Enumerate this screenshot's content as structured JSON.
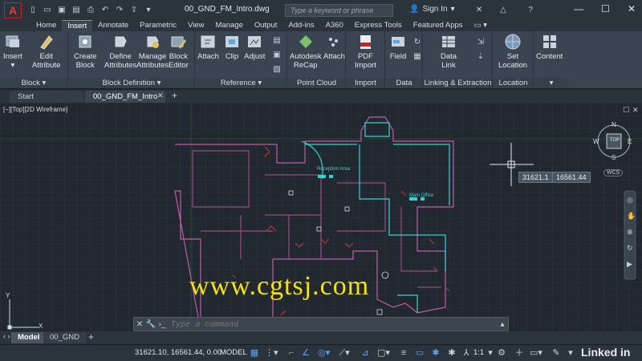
{
  "window": {
    "doc_title": "00_GND_FM_Intro.dwg",
    "search_placeholder": "Type a keyword or phrase",
    "sign_in": "Sign In",
    "minimize": "—",
    "maximize": "☐",
    "close": "✕"
  },
  "ribbon_tabs": [
    "Home",
    "Insert",
    "Annotate",
    "Parametric",
    "View",
    "Manage",
    "Output",
    "Add-ins",
    "A360",
    "Express Tools",
    "Featured Apps"
  ],
  "ribbon": {
    "insert": "Insert",
    "edit_attribute": [
      "Edit",
      "Attribute"
    ],
    "create_block": [
      "Create",
      "Block"
    ],
    "define_attributes": [
      "Define",
      "Attributes"
    ],
    "manage_attributes": [
      "Manage",
      "Attributes"
    ],
    "block_editor": [
      "Block",
      "Editor"
    ],
    "attach": "Attach",
    "clip": "Clip",
    "adjust": "Adjust",
    "recap": [
      "Autodesk",
      "ReCap"
    ],
    "attach2": "Attach",
    "pdf_import": [
      "PDF",
      "Import"
    ],
    "field": "Field",
    "data_link": [
      "Data",
      "Link"
    ],
    "set_location": [
      "Set",
      "Location"
    ],
    "content": "Content",
    "panel_block": "Block",
    "panel_block_def": "Block Definition",
    "panel_reference": "Reference",
    "panel_point_cloud": "Point Cloud",
    "panel_import": "Import",
    "panel_data": "Data",
    "panel_linking": "Linking & Extraction",
    "panel_location": "Location"
  },
  "doc_tabs": {
    "start": "Start",
    "current": "00_GND_FM_Intro",
    "close": "✕",
    "add": "+"
  },
  "viewport": {
    "label": "[−][Top][2D Wireframe]",
    "watermark": "www.cgtsj.com",
    "coord_x": "31621.1",
    "coord_y": "16561.44",
    "room_reception": "Reception Area",
    "room_office": "Main Office",
    "viewcube_top": "TOP",
    "compass_n": "N",
    "compass_s": "S",
    "compass_e": "E",
    "compass_w": "W",
    "wcs": "WCS",
    "ucs_y": "Y",
    "ucs_x": "X"
  },
  "command": {
    "placeholder": "Type a command"
  },
  "layout_tabs": {
    "model": "Model",
    "layout": "00_GND",
    "add": "+"
  },
  "status": {
    "coords": "31621.10, 16561.44, 0.00",
    "model": "MODEL",
    "scale": "1:1",
    "brand": "Linked in"
  }
}
